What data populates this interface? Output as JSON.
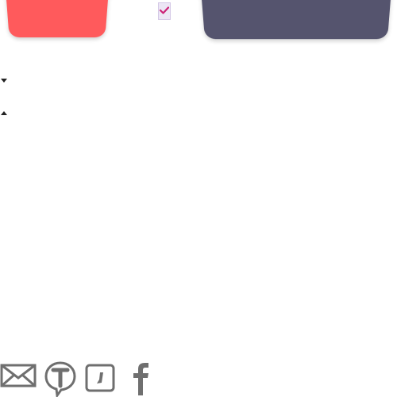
{
  "tabs": [
    {
      "name": "tab-red",
      "color": "#ff5a5c"
    },
    {
      "name": "tab-purple",
      "color": "#55546e"
    }
  ],
  "checkbox": {
    "checked": true,
    "check_color": "#cc2277"
  },
  "toggles": [
    {
      "name": "collapse-toggle-down",
      "icon": "triangle-down-icon"
    },
    {
      "name": "collapse-toggle-up",
      "icon": "triangle-up-icon"
    }
  ],
  "share_icons": [
    "mail-icon",
    "t-speech-bubble-icon",
    "comma-square-icon",
    "facebook-icon"
  ],
  "icon_color": "#6f6f6f"
}
